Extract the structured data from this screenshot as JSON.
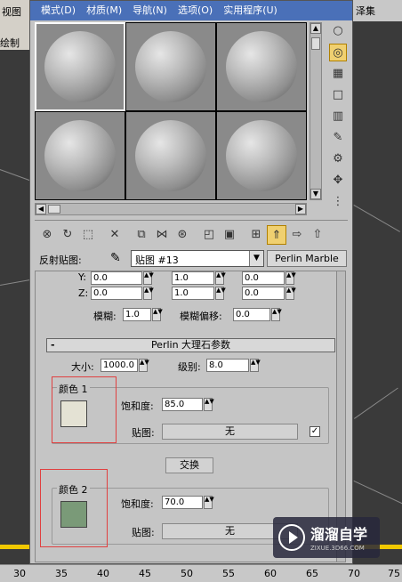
{
  "background": {
    "left_labels": [
      "视图",
      "绘制"
    ],
    "right_label": "泽集",
    "ruler_ticks": [
      "30",
      "35",
      "40",
      "45",
      "50",
      "55",
      "60",
      "65",
      "70",
      "75"
    ]
  },
  "menubar": {
    "items": [
      "模式(D)",
      "材质(M)",
      "导航(N)",
      "选项(O)",
      "实用程序(U)"
    ]
  },
  "map_row": {
    "label": "反射贴图:",
    "map_name": "贴图 #13",
    "type_button": "Perlin Marble"
  },
  "coords": {
    "y_label": "Y:",
    "z_label": "Z:",
    "y_vals": [
      "0.0",
      "1.0",
      "0.0"
    ],
    "z_vals": [
      "0.0",
      "1.0",
      "0.0"
    ],
    "blur_label": "模糊:",
    "blur_value": "1.0",
    "blur_offset_label": "模糊偏移:",
    "blur_offset_value": "0.0"
  },
  "perlin": {
    "title": "Perlin 大理石参数",
    "collapse": "-",
    "size_label": "大小:",
    "size_value": "1000.0",
    "levels_label": "级别:",
    "levels_value": "8.0"
  },
  "color1": {
    "label": "颜色 1",
    "color": "#e4e2d4",
    "saturation_label": "饱和度:",
    "saturation_value": "85.0",
    "map_label": "贴图:",
    "map_value": "无",
    "checked": "✓"
  },
  "swap_label": "交换",
  "color2": {
    "label": "颜色 2",
    "color": "#7a9a78",
    "saturation_label": "饱和度:",
    "saturation_value": "70.0",
    "map_label": "贴图:",
    "map_value": "无"
  },
  "watermark": {
    "title": "溜溜自学",
    "url": "ZIXUE.3D66.COM"
  }
}
